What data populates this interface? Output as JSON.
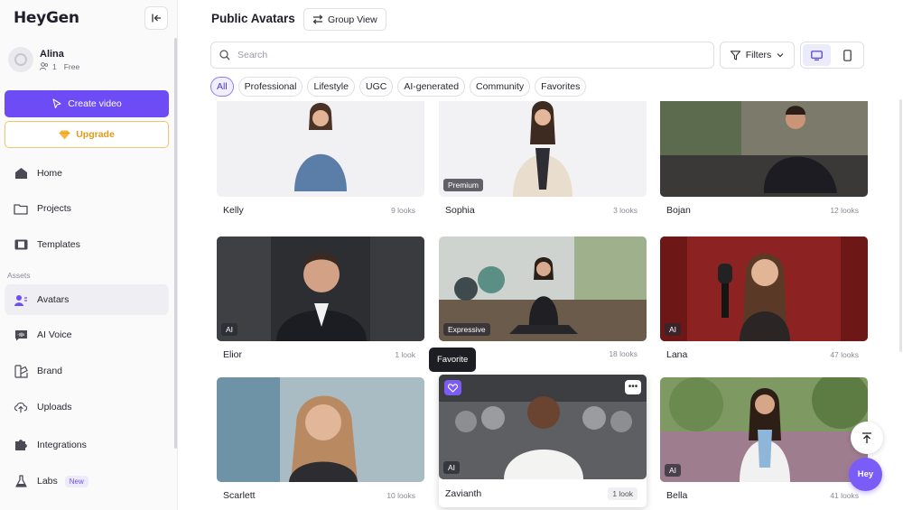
{
  "brand": {
    "logo_text": "HeyGen",
    "accent": "#6d4cf5"
  },
  "user": {
    "name": "Alina",
    "seats": "1",
    "plan": "Free"
  },
  "sidebar": {
    "create_label": "Create video",
    "upgrade_label": "Upgrade",
    "section_assets": "Assets",
    "items": [
      {
        "label": "Home",
        "icon": "home-icon"
      },
      {
        "label": "Projects",
        "icon": "folder-icon"
      },
      {
        "label": "Templates",
        "icon": "film-icon"
      },
      {
        "label": "Avatars",
        "icon": "avatar-icon",
        "active": true
      },
      {
        "label": "AI Voice",
        "icon": "voice-icon"
      },
      {
        "label": "Brand",
        "icon": "brand-icon"
      },
      {
        "label": "Uploads",
        "icon": "upload-icon"
      },
      {
        "label": "Integrations",
        "icon": "puzzle-icon"
      },
      {
        "label": "Labs",
        "icon": "flask-icon",
        "badge": "New"
      }
    ]
  },
  "header": {
    "title": "Public Avatars",
    "group_view_label": "Group View"
  },
  "search": {
    "placeholder": "Search",
    "value": ""
  },
  "filters_label": "Filters",
  "chips": [
    "All",
    "Professional",
    "Lifestyle",
    "UGC",
    "AI-generated",
    "Community",
    "Favorites"
  ],
  "active_chip": "All",
  "avatars": [
    {
      "name": "Kelly",
      "looks": "9 looks",
      "tag": ""
    },
    {
      "name": "Sophia",
      "looks": "3 looks",
      "tag": "Premium"
    },
    {
      "name": "Bojan",
      "looks": "12 looks",
      "tag": ""
    },
    {
      "name": "Elior",
      "looks": "1 look",
      "tag": "AI"
    },
    {
      "name": "",
      "looks": "18 looks",
      "tag": "Expressive"
    },
    {
      "name": "Lana",
      "looks": "47 looks",
      "tag": "AI"
    },
    {
      "name": "Scarlett",
      "looks": "10 looks",
      "tag": ""
    },
    {
      "name": "Zavianth",
      "looks": "1 look",
      "tag": "AI"
    },
    {
      "name": "Bella",
      "looks": "41 looks",
      "tag": "AI"
    }
  ],
  "tooltip": "Favorite",
  "chat_button_label": "Hey"
}
